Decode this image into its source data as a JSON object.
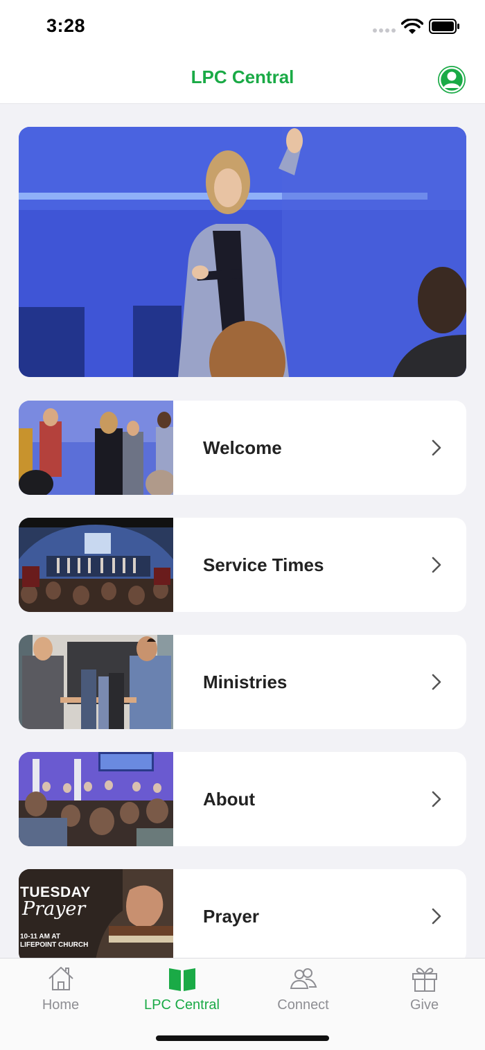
{
  "status_bar": {
    "time": "3:28"
  },
  "nav": {
    "title": "LPC Central"
  },
  "menu": [
    {
      "label": "Welcome"
    },
    {
      "label": "Service Times"
    },
    {
      "label": "Ministries"
    },
    {
      "label": "About"
    },
    {
      "label": "Prayer"
    }
  ],
  "prayer_thumb": {
    "line1": "TUESDAY",
    "line2": "Prayer",
    "line3": "10-11 AM AT",
    "line4": "LIFEPOINT CHURCH"
  },
  "tabs": [
    {
      "label": "Home",
      "icon": "house-icon"
    },
    {
      "label": "LPC Central",
      "icon": "book-icon",
      "active": true
    },
    {
      "label": "Connect",
      "icon": "people-icon"
    },
    {
      "label": "Give",
      "icon": "gift-icon"
    }
  ],
  "colors": {
    "accent": "#1aaa46",
    "inactive": "#8e8e93",
    "background": "#f2f2f6"
  }
}
